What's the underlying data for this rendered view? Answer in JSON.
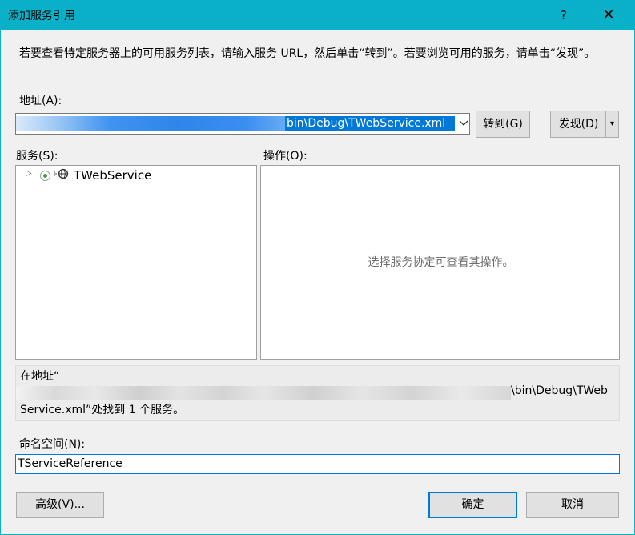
{
  "window": {
    "title": "添加服务引用",
    "help": "?",
    "close": "✕"
  },
  "description": "若要查看特定服务器上的可用服务列表，请输入服务 URL，然后单击“转到”。若要浏览可用的服务，请单击“发现”。",
  "address": {
    "label": "地址(A):",
    "value_visible": "bin\\Debug\\TWebService.xml",
    "dropdown_icon": "chevron-down-icon"
  },
  "buttons": {
    "go": "转到(G)",
    "discover": "发现(D)",
    "discover_arrow": "▾",
    "advanced": "高级(V)...",
    "ok": "确定",
    "cancel": "取消"
  },
  "services": {
    "label": "服务(S):",
    "items": [
      {
        "label": "TWebService",
        "expander": "▷",
        "icon": "globe-icon"
      }
    ]
  },
  "operations": {
    "label": "操作(O):",
    "hint": "选择服务协定可查看其操作。"
  },
  "status": {
    "line1": "在地址“",
    "path_visible": "\\bin\\Debug\\TWeb",
    "line3": "Service.xml”处找到 1 个服务。"
  },
  "namespace": {
    "label": "命名空间(N):",
    "value": "TServiceReference"
  },
  "colors": {
    "titlebar": "#0ab0c8",
    "accent": "#0078d7",
    "background": "#f0f0f0"
  }
}
